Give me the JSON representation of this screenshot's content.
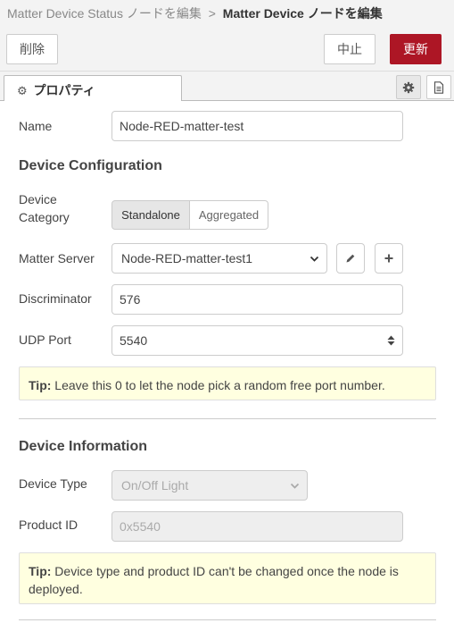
{
  "breadcrumb": {
    "parent": "Matter Device Status ノードを編集",
    "separator": ">",
    "current": "Matter Device ノードを編集"
  },
  "toolbar": {
    "delete_label": "削除",
    "cancel_label": "中止",
    "update_label": "更新",
    "update_color": "#AD1625"
  },
  "tabs": {
    "properties_label": "プロパティ",
    "properties_icon": "gear-icon",
    "settings_icon": "gear-icon",
    "description_icon": "file-text-icon"
  },
  "form": {
    "name_label": "Name",
    "name_value": "Node-RED-matter-test",
    "device_config_heading": "Device Configuration",
    "device_category_label_1": "Device",
    "device_category_label_2": "Category",
    "category_options": [
      "Standalone",
      "Aggregated"
    ],
    "category_selected": "Standalone",
    "matter_server_label": "Matter Server",
    "matter_server_value": "Node-RED-matter-test1",
    "discriminator_label": "Discriminator",
    "discriminator_value": "576",
    "udp_port_label": "UDP Port",
    "udp_port_value": "5540",
    "tip1_prefix": "Tip:",
    "tip1_text": " Leave this 0 to let the node pick a random free port number.",
    "device_info_heading": "Device Information",
    "device_type_label": "Device Type",
    "device_type_value": "On/Off Light",
    "product_id_label": "Product ID",
    "product_id_placeholder": "0x5540",
    "tip2_prefix": "Tip:",
    "tip2_text": " Device type and product ID can't be changed once the node is deployed."
  }
}
